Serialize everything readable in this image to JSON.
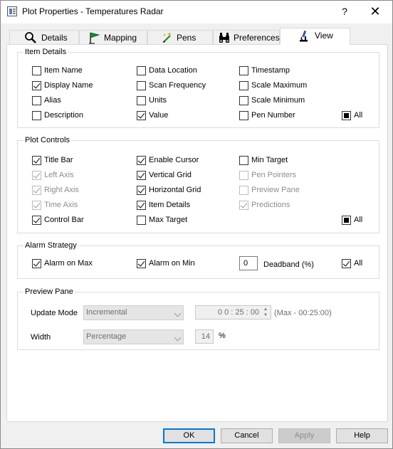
{
  "window": {
    "title": "Plot Properties - Temperatures Radar",
    "help_glyph": "?",
    "close_glyph": "✕"
  },
  "tabs": [
    {
      "label": "Details",
      "icon": "magnifier-icon",
      "active": false
    },
    {
      "label": "Mapping",
      "icon": "flag-icon",
      "active": false
    },
    {
      "label": "Pens",
      "icon": "pen-sparkle-icon",
      "active": false
    },
    {
      "label": "Preferences",
      "icon": "binoculars-icon",
      "active": false
    },
    {
      "label": "View",
      "icon": "microscope-icon",
      "active": true
    }
  ],
  "item_details": {
    "title": "Item Details",
    "item_name": "Item Name",
    "display_name": "Display Name",
    "alias": "Alias",
    "description": "Description",
    "data_location": "Data Location",
    "scan_frequency": "Scan Frequency",
    "units": "Units",
    "value": "Value",
    "timestamp": "Timestamp",
    "scale_maximum": "Scale Maximum",
    "scale_minimum": "Scale Minimum",
    "pen_number": "Pen Number",
    "all": "All"
  },
  "plot_controls": {
    "title": "Plot Controls",
    "title_bar": "Title Bar",
    "left_axis": "Left Axis",
    "right_axis": "Right Axis",
    "time_axis": "Time Axis",
    "control_bar": "Control Bar",
    "enable_cursor": "Enable Cursor",
    "vertical_grid": "Vertical Grid",
    "horizontal_grid": "Horizontal Grid",
    "item_details": "Item Details",
    "max_target": "Max Target",
    "min_target": "Min Target",
    "pen_pointers": "Pen Pointers",
    "preview_pane": "Preview Pane",
    "predictions": "Predictions",
    "all": "All"
  },
  "alarm_strategy": {
    "title": "Alarm Strategy",
    "alarm_on_max": "Alarm on Max",
    "alarm_on_min": "Alarm on Min",
    "deadband_value": "0",
    "deadband_label": "Deadband (%)",
    "all": "All"
  },
  "preview_pane": {
    "title": "Preview Pane",
    "update_mode_label": "Update Mode",
    "update_mode_value": "Incremental",
    "time_value": "0   0 : 25 : 00",
    "time_hint": "(Max - 00:25:00)",
    "width_label": "Width",
    "width_mode_value": "Percentage",
    "width_value": "14",
    "width_unit": "%"
  },
  "buttons": {
    "ok": "OK",
    "cancel": "Cancel",
    "apply": "Apply",
    "help": "Help"
  },
  "colors": {
    "accent": "#0078d7",
    "flag_green": "#1f8a2e",
    "icon_blue": "#2d5aa0"
  }
}
